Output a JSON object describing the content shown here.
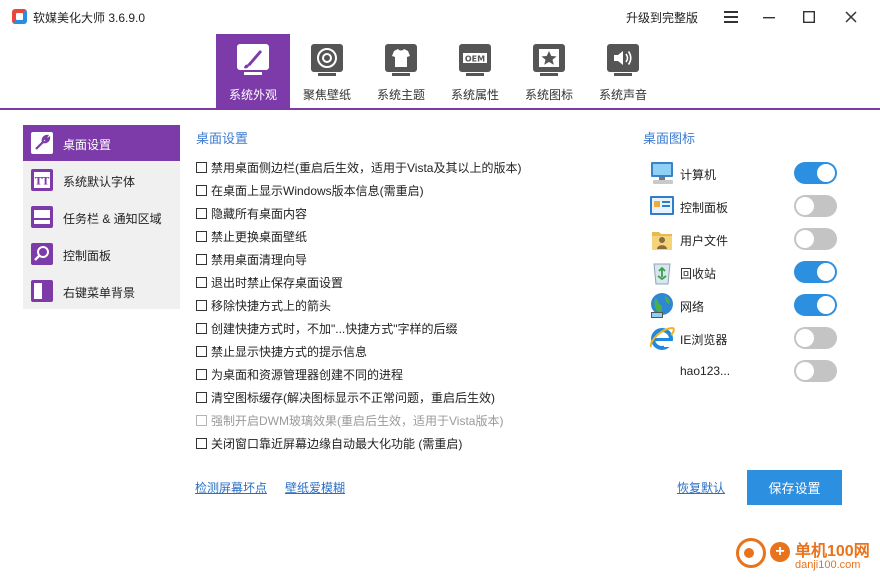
{
  "app": {
    "title": "软媒美化大师 3.6.9.0",
    "upgrade_label": "升级到完整版"
  },
  "tabs": [
    {
      "label": "系统外观",
      "icon": "paintbrush-icon",
      "active": true
    },
    {
      "label": "聚焦壁纸",
      "icon": "focus-target-icon",
      "active": false
    },
    {
      "label": "系统主题",
      "icon": "tshirt-icon",
      "active": false
    },
    {
      "label": "系统属性",
      "icon": "oem-icon",
      "active": false
    },
    {
      "label": "系统图标",
      "icon": "star-icon",
      "active": false
    },
    {
      "label": "系统声音",
      "icon": "speaker-icon",
      "active": false
    }
  ],
  "sidebar": {
    "items": [
      {
        "label": "桌面设置",
        "icon": "wrench-icon",
        "active": true
      },
      {
        "label": "系统默认字体",
        "icon": "font-tt-icon",
        "active": false
      },
      {
        "label": "任务栏 & 通知区域",
        "icon": "taskbar-icon",
        "active": false
      },
      {
        "label": "控制面板",
        "icon": "magnifier-icon",
        "active": false
      },
      {
        "label": "右键菜单背景",
        "icon": "context-menu-icon",
        "active": false
      }
    ]
  },
  "desktop_settings": {
    "title": "桌面设置",
    "options": [
      {
        "label": "禁用桌面侧边栏(重启后生效，适用于Vista及其以上的版本)",
        "checked": false,
        "disabled": false
      },
      {
        "label": "在桌面上显示Windows版本信息(需重启)",
        "checked": false,
        "disabled": false
      },
      {
        "label": "隐藏所有桌面内容",
        "checked": false,
        "disabled": false
      },
      {
        "label": "禁止更换桌面壁纸",
        "checked": false,
        "disabled": false
      },
      {
        "label": "禁用桌面清理向导",
        "checked": false,
        "disabled": false
      },
      {
        "label": "退出时禁止保存桌面设置",
        "checked": false,
        "disabled": false
      },
      {
        "label": "移除快捷方式上的箭头",
        "checked": false,
        "disabled": false
      },
      {
        "label": "创建快捷方式时，不加\"...快捷方式\"字样的后缀",
        "checked": false,
        "disabled": false
      },
      {
        "label": "禁止显示快捷方式的提示信息",
        "checked": false,
        "disabled": false
      },
      {
        "label": "为桌面和资源管理器创建不同的进程",
        "checked": false,
        "disabled": false
      },
      {
        "label": "清空图标缓存(解决图标显示不正常问题，重启后生效)",
        "checked": false,
        "disabled": false
      },
      {
        "label": "强制开启DWM玻璃效果(重启后生效，适用于Vista版本)",
        "checked": false,
        "disabled": true
      },
      {
        "label": "关闭窗口靠近屏幕边缘自动最大化功能 (需重启)",
        "checked": false,
        "disabled": false
      }
    ]
  },
  "desktop_icons": {
    "title": "桌面图标",
    "items": [
      {
        "label": "计算机",
        "icon": "computer-icon",
        "on": true
      },
      {
        "label": "控制面板",
        "icon": "control-panel-icon",
        "on": false
      },
      {
        "label": "用户文件",
        "icon": "user-folder-icon",
        "on": false
      },
      {
        "label": "回收站",
        "icon": "recycle-bin-icon",
        "on": true
      },
      {
        "label": "网络",
        "icon": "network-globe-icon",
        "on": true
      },
      {
        "label": "IE浏览器",
        "icon": "ie-browser-icon",
        "on": false
      },
      {
        "label": "hao123...",
        "icon": "",
        "on": false
      }
    ]
  },
  "footer": {
    "detect_pixels_label": "检测屏幕坏点",
    "wallpaper_blur_label": "壁纸爱模糊",
    "restore_default_label": "恢复默认",
    "save_label": "保存设置"
  },
  "watermark": {
    "name": "单机100网",
    "url": "danji100.com"
  },
  "colors": {
    "accent_purple": "#7d3aa9",
    "link_blue": "#2b6fc5",
    "toggle_on": "#2d8fe0",
    "toggle_off": "#c4c4c4",
    "section_title": "#3c7bd1"
  }
}
